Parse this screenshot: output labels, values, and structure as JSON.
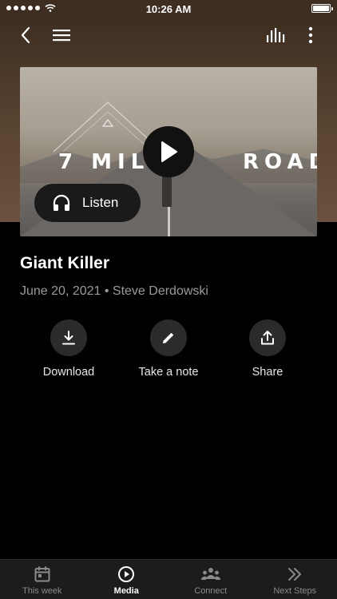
{
  "status_bar": {
    "time": "10:26 AM"
  },
  "header": {
    "back_icon": "chevron-left-icon",
    "menu_icon": "hamburger-icon",
    "audio_icon": "audio-bars-icon",
    "more_icon": "more-vertical-icon"
  },
  "media": {
    "graphic_title_left": "7 MILE",
    "graphic_title_right": "ROAD",
    "play_icon": "play-icon",
    "listen_label": "Listen"
  },
  "sermon": {
    "title": "Giant Killer",
    "meta": "June 20, 2021 • Steve Derdowski"
  },
  "actions": [
    {
      "label": "Download",
      "icon": "download-icon"
    },
    {
      "label": "Take a note",
      "icon": "pencil-icon"
    },
    {
      "label": "Share",
      "icon": "share-icon"
    }
  ],
  "tabs": [
    {
      "label": "This week",
      "icon": "calendar-icon",
      "active": false
    },
    {
      "label": "Media",
      "icon": "play-circle-icon",
      "active": true
    },
    {
      "label": "Connect",
      "icon": "people-icon",
      "active": false
    },
    {
      "label": "Next Steps",
      "icon": "chevrons-right-icon",
      "active": false
    }
  ],
  "colors": {
    "background": "#000000",
    "header_brown": "#3d2e21",
    "tab_bar": "#1c1c1c",
    "action_circle": "#2b2b2b"
  }
}
